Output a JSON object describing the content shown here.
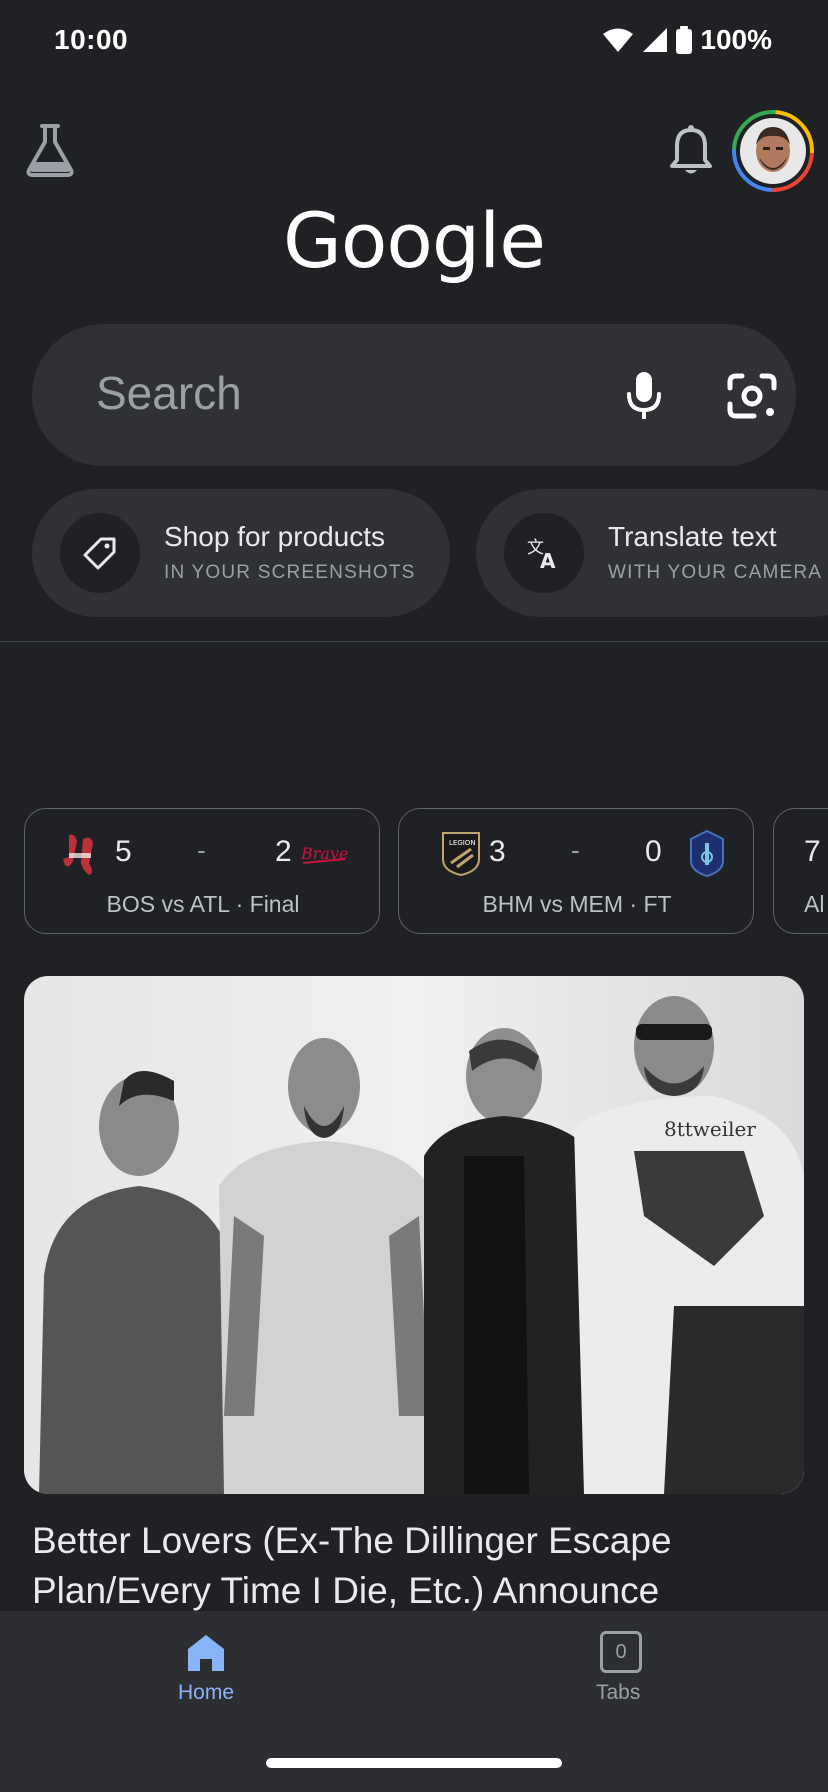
{
  "status_bar": {
    "time": "10:00",
    "battery": "100%",
    "icons": [
      "wifi-icon",
      "signal-icon",
      "battery-icon"
    ]
  },
  "header": {
    "logo_text": "Google",
    "icons": [
      "labs-flask-icon",
      "notifications-bell-icon",
      "account-avatar"
    ]
  },
  "search": {
    "placeholder": "Search",
    "icons": [
      "microphone-icon",
      "google-lens-icon"
    ]
  },
  "chips": [
    {
      "title": "Shop for products",
      "subtitle": "IN YOUR SCREENSHOTS",
      "icon": "price-tag-icon"
    },
    {
      "title": "Translate text",
      "subtitle": "WITH YOUR CAMERA",
      "icon": "translate-icon"
    }
  ],
  "scores": [
    {
      "home_score": "5",
      "away_score": "2",
      "separator": "-",
      "status": "BOS vs ATL · Final",
      "home_logo": "red-sox-logo",
      "away_logo": "braves-logo"
    },
    {
      "home_score": "3",
      "away_score": "0",
      "separator": "-",
      "status": "BHM vs MEM · FT",
      "home_logo": "legion-logo",
      "away_logo": "memphis-logo"
    },
    {
      "home_score": "7",
      "status": "Al"
    }
  ],
  "news": {
    "title": "Better Lovers (Ex-The Dillinger Escape Plan/Every Time I Die, Etc.) Announce"
  },
  "bottom_nav": {
    "home_label": "Home",
    "tabs_label": "Tabs",
    "tabs_count": "0"
  },
  "colors": {
    "background": "#202124",
    "surface": "#303134",
    "accent_blue": "#8ab4f8",
    "text_primary": "#e8eaed",
    "text_secondary": "#9aa0a6"
  }
}
